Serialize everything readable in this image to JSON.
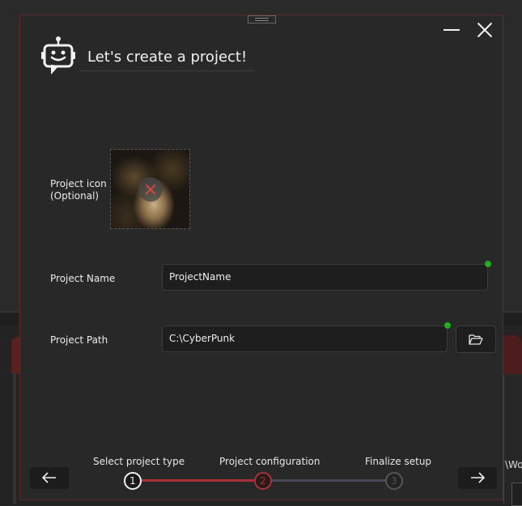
{
  "dialog": {
    "title": "Let's create a project!"
  },
  "form": {
    "icon_label": "Project icon\n(Optional)",
    "icon_label_line1": "Project icon",
    "icon_label_line2": "(Optional)",
    "name_label": "Project Name",
    "name_value": "ProjectName",
    "path_label": "Project Path",
    "path_value": "C:\\CyberPunk"
  },
  "wizard": {
    "steps": [
      {
        "number": "1",
        "label": "Select project type",
        "state": "done"
      },
      {
        "number": "2",
        "label": "Project configuration",
        "state": "current"
      },
      {
        "number": "3",
        "label": "Finalize setup",
        "state": "pending"
      }
    ]
  },
  "background": {
    "partial_text": "\\Wo"
  },
  "colors": {
    "accent": "#b0363e",
    "valid": "#1fae1f",
    "dialog_bg": "#282828"
  },
  "icons": [
    "robot-chat-icon",
    "minimize-icon",
    "close-icon",
    "remove-icon",
    "folder-open-icon",
    "arrow-left-icon",
    "arrow-right-icon",
    "drag-grip-icon"
  ]
}
